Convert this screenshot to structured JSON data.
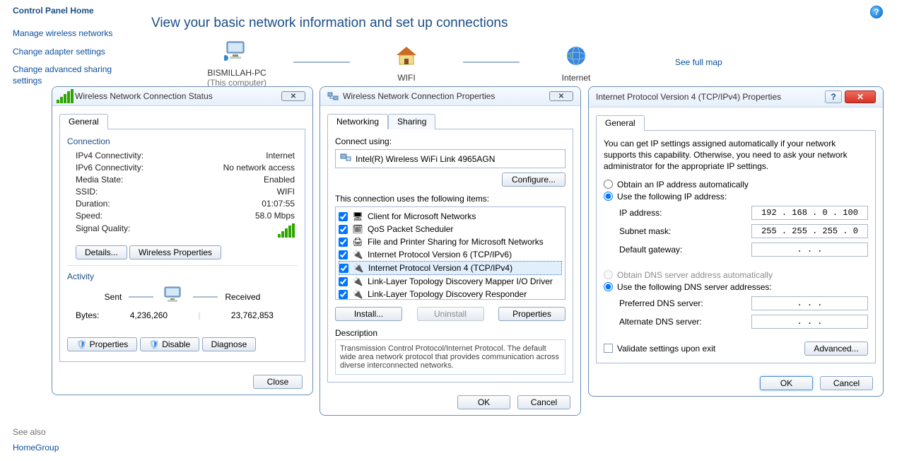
{
  "sidebar": {
    "title": "Control Panel Home",
    "links": [
      "Manage wireless networks",
      "Change adapter settings",
      "Change advanced sharing settings"
    ],
    "see_also": "See also",
    "homegroup": "HomeGroup"
  },
  "header": {
    "title": "View your basic network information and set up connections",
    "full_map": "See full map"
  },
  "map": {
    "pc": "BISMILLAH-PC",
    "pc_sub": "(This computer)",
    "wifi": "WIFI",
    "internet": "Internet"
  },
  "win1": {
    "title": "Wireless Network Connection Status",
    "tab_general": "General",
    "section_connection": "Connection",
    "rows": {
      "ipv4_k": "IPv4 Connectivity:",
      "ipv4_v": "Internet",
      "ipv6_k": "IPv6 Connectivity:",
      "ipv6_v": "No network access",
      "media_k": "Media State:",
      "media_v": "Enabled",
      "ssid_k": "SSID:",
      "ssid_v": "WIFI",
      "dur_k": "Duration:",
      "dur_v": "01:07:55",
      "speed_k": "Speed:",
      "speed_v": "58.0 Mbps",
      "sig_k": "Signal Quality:"
    },
    "btn_details": "Details...",
    "btn_wprops": "Wireless Properties",
    "section_activity": "Activity",
    "sent": "Sent",
    "received": "Received",
    "bytes_k": "Bytes:",
    "bytes_sent": "4,236,260",
    "bytes_recv": "23,762,853",
    "btn_props": "Properties",
    "btn_disable": "Disable",
    "btn_diag": "Diagnose",
    "btn_close": "Close"
  },
  "win2": {
    "title": "Wireless Network Connection Properties",
    "tab_net": "Networking",
    "tab_share": "Sharing",
    "connect_using": "Connect using:",
    "adapter": "Intel(R) Wireless WiFi Link 4965AGN",
    "btn_configure": "Configure...",
    "uses_label": "This connection uses the following items:",
    "items": [
      "Client for Microsoft Networks",
      "QoS Packet Scheduler",
      "File and Printer Sharing for Microsoft Networks",
      "Internet Protocol Version 6 (TCP/IPv6)",
      "Internet Protocol Version 4 (TCP/IPv4)",
      "Link-Layer Topology Discovery Mapper I/O Driver",
      "Link-Layer Topology Discovery Responder"
    ],
    "btn_install": "Install...",
    "btn_uninstall": "Uninstall",
    "btn_props": "Properties",
    "desc_label": "Description",
    "desc_text": "Transmission Control Protocol/Internet Protocol. The default wide area network protocol that provides communication across diverse interconnected networks.",
    "btn_ok": "OK",
    "btn_cancel": "Cancel"
  },
  "win3": {
    "title": "Internet Protocol Version 4 (TCP/IPv4) Properties",
    "tab_general": "General",
    "blurb": "You can get IP settings assigned automatically if your network supports this capability. Otherwise, you need to ask your network administrator for the appropriate IP settings.",
    "r_auto": "Obtain an IP address automatically",
    "r_manual": "Use the following IP address:",
    "ip_k": "IP address:",
    "ip_v": "192 . 168 .  0  . 100",
    "mask_k": "Subnet mask:",
    "mask_v": "255 . 255 . 255 .  0",
    "gw_k": "Default gateway:",
    "gw_v": " .       .       .",
    "r_dnsa": "Obtain DNS server address automatically",
    "r_dnsm": "Use the following DNS server addresses:",
    "dns1_k": "Preferred DNS server:",
    "dns1_v": " .       .       .",
    "dns2_k": "Alternate DNS server:",
    "dns2_v": " .       .       .",
    "chk_validate": "Validate settings upon exit",
    "btn_adv": "Advanced...",
    "btn_ok": "OK",
    "btn_cancel": "Cancel"
  }
}
